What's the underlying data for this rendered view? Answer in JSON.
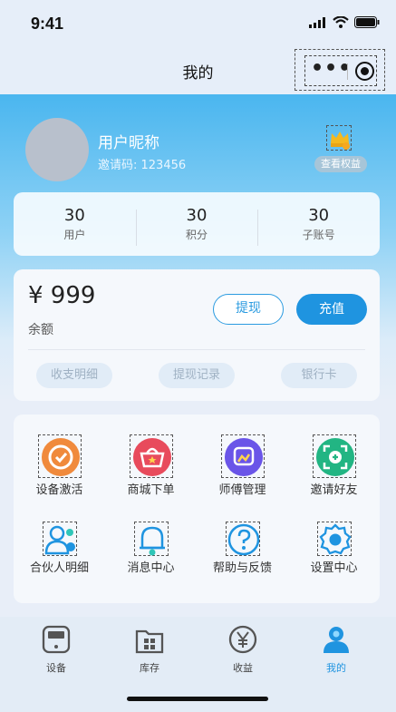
{
  "status_bar": {
    "time": "9:41"
  },
  "navbar": {
    "title": "我的"
  },
  "profile": {
    "nickname": "用户昵称",
    "invite_code": "邀请码: 123456",
    "benefits_label": "查看权益"
  },
  "stats": [
    {
      "value": "30",
      "label": "用户"
    },
    {
      "value": "30",
      "label": "积分"
    },
    {
      "value": "30",
      "label": "子账号"
    }
  ],
  "balance": {
    "amount": "¥ 999",
    "label": "余额",
    "withdraw_label": "提现",
    "recharge_label": "充值",
    "chips": [
      "收支明细",
      "提现记录",
      "银行卡"
    ]
  },
  "menu": [
    {
      "label": "设备激活",
      "icon": "device-activate-icon",
      "color": "#f08a3c"
    },
    {
      "label": "商城下单",
      "icon": "shopping-basket-icon",
      "color": "#e84b5c"
    },
    {
      "label": "师傅管理",
      "icon": "worker-manage-icon",
      "color": "#6a55e8"
    },
    {
      "label": "邀请好友",
      "icon": "invite-friend-icon",
      "color": "#22b583"
    },
    {
      "label": "合伙人明细",
      "icon": "partner-icon",
      "color": "#1f94e0"
    },
    {
      "label": "消息中心",
      "icon": "bell-icon",
      "color": "#1f94e0"
    },
    {
      "label": "帮助与反馈",
      "icon": "help-icon",
      "color": "#1f94e0"
    },
    {
      "label": "设置中心",
      "icon": "gear-icon",
      "color": "#1f94e0"
    }
  ],
  "tabs": [
    {
      "label": "设备",
      "icon": "device-icon"
    },
    {
      "label": "库存",
      "icon": "inventory-icon"
    },
    {
      "label": "收益",
      "icon": "yen-icon"
    },
    {
      "label": "我的",
      "icon": "user-icon",
      "active": true
    }
  ],
  "colors": {
    "accent": "#1f94e0",
    "header": "#4ab6ef"
  }
}
